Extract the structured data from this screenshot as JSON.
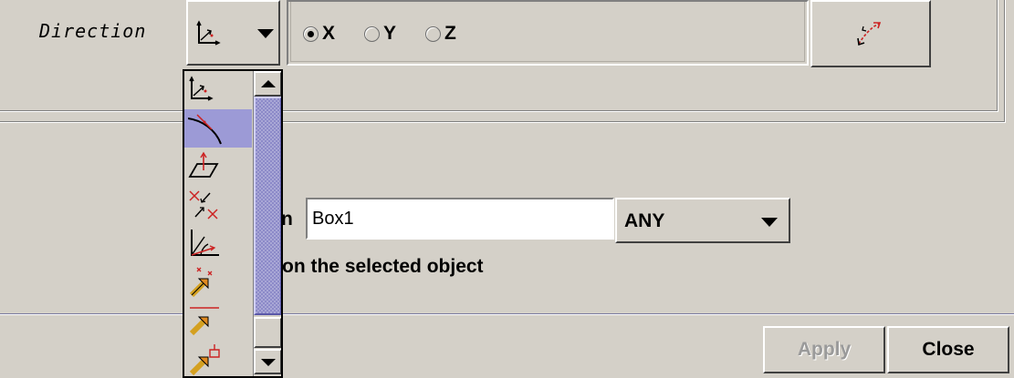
{
  "direction": {
    "label": "Direction",
    "selected_icon": "axes-vector-icon",
    "radios": [
      {
        "label": "X",
        "checked": true
      },
      {
        "label": "Y",
        "checked": false
      },
      {
        "label": "Z",
        "checked": false
      }
    ],
    "reverse_icon": "reverse-direction-icon"
  },
  "dropdown": {
    "items": [
      {
        "icon": "axes-vector-icon",
        "selected": false
      },
      {
        "icon": "curve-tangent-icon",
        "selected": true
      },
      {
        "icon": "plane-normal-icon",
        "selected": false
      },
      {
        "icon": "two-points-icon",
        "selected": false
      },
      {
        "icon": "angle-axes-icon",
        "selected": false
      },
      {
        "icon": "point-to-point-vector-icon",
        "selected": false
      },
      {
        "icon": "line-vector-icon",
        "selected": false
      },
      {
        "icon": "face-normal-vector-icon",
        "selected": false
      }
    ]
  },
  "name_row": {
    "label_fragment": "n",
    "value": "Box1",
    "type_value": "ANY"
  },
  "hint_text": "on the selected object",
  "buttons": {
    "apply_label": "Apply",
    "apply_enabled": false,
    "close_label": "Close"
  },
  "colors": {
    "background": "#d4d0c8",
    "selection": "#9c9ad6",
    "scroll_thumb": "#8c8ac8",
    "icon_red": "#cc2222"
  }
}
